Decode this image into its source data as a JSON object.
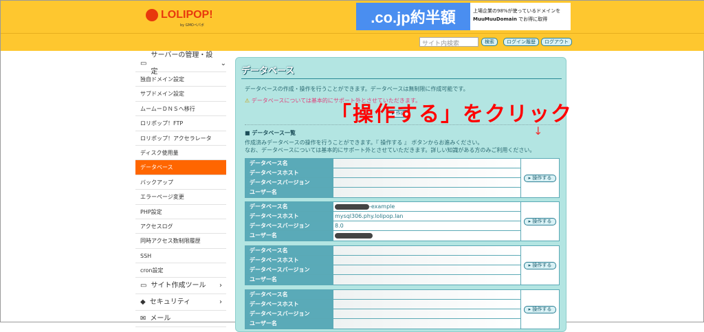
{
  "header": {
    "logo": "LOLIPOP!",
    "logo_sub": "by GMOペパボ",
    "ad_left": ".co.jp約半額",
    "ad_right_line1": "上場企業の98%が使っているドメインを",
    "ad_right_brand": "MuuMuuDomain",
    "ad_right_line2": "でお得に取得",
    "search_placeholder": "サイト内検索",
    "search_btn": "検索",
    "login_history_btn": "ログイン履歴",
    "logout_btn": "ログアウト"
  },
  "sidebar": {
    "section1": "サーバーの管理・設定",
    "items": [
      "独自ドメイン設定",
      "サブドメイン設定",
      "ムームーＤＮＳへ移行",
      "ロリポップ！FTP",
      "ロリポップ！アクセラレータ",
      "ディスク使用量",
      "データベース",
      "バックアップ",
      "エラーページ変更",
      "PHP設定",
      "アクセスログ",
      "同時アクセス数制限履歴",
      "SSH",
      "cron設定"
    ],
    "section2": "サイト作成ツール",
    "section3": "セキュリティ",
    "section4": "メール"
  },
  "main": {
    "title": "データベース",
    "intro": "データベースの作成・操作を行うことができます。データベースは無制限に作成可能です。",
    "warning": "データベースについては基本的にサポート外とさせていただきます。",
    "create_btn": "作成",
    "list_heading": "■ データベース一覧",
    "list_desc1": "作成済みデータベースの操作を行うことができます。『 操作する 』 ボタンからお進みください。",
    "list_desc2": "なお、データベースについては基本的にサポート外とさせていただきます。詳しい知識がある方のみご利用ください。",
    "labels": [
      "データベース名",
      "データベースホスト",
      "データベースバージョン",
      "ユーザー名"
    ],
    "op_btn": "操作する",
    "db2": {
      "name_suffix": "-example",
      "host": "mysql306.phy.lolipop.lan",
      "version": "8.0"
    }
  },
  "annotation": {
    "text": "「操作する」をクリック",
    "arrow": "↓"
  }
}
